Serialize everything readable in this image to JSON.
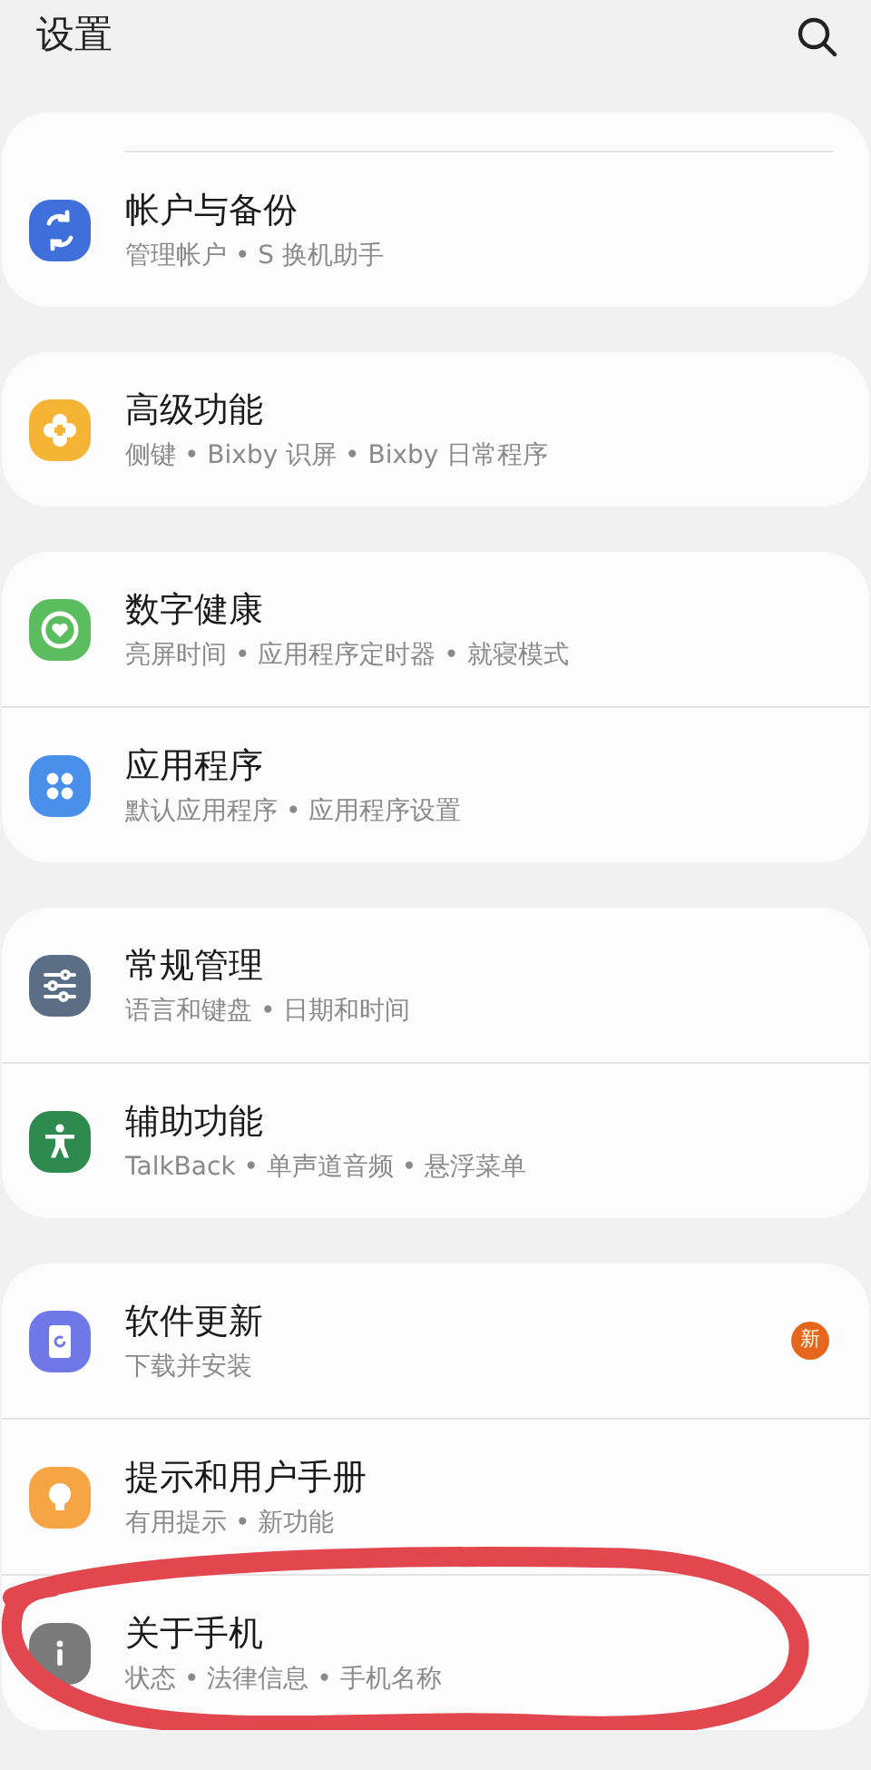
{
  "header": {
    "title": "设置"
  },
  "sections": [
    {
      "scrolled_under_header": true,
      "items": [
        {
          "kind": "sync",
          "color": "#3f6fdb",
          "title": "帐户与备份",
          "subtitle": "管理帐户 • S 换机助手"
        }
      ]
    },
    {
      "items": [
        {
          "kind": "plus-flower",
          "color": "#f6b437",
          "title": "高级功能",
          "subtitle": "侧键 • Bixby 识屏 • Bixby 日常程序"
        }
      ]
    },
    {
      "items": [
        {
          "kind": "heart-ring",
          "color": "#5cbd5e",
          "title": "数字健康",
          "subtitle": "亮屏时间 • 应用程序定时器 • 就寝模式"
        },
        {
          "kind": "dots",
          "color": "#4a90ea",
          "title": "应用程序",
          "subtitle": "默认应用程序 • 应用程序设置"
        }
      ]
    },
    {
      "items": [
        {
          "kind": "sliders",
          "color": "#5a6e86",
          "title": "常规管理",
          "subtitle": "语言和键盘 • 日期和时间"
        },
        {
          "kind": "person",
          "color": "#2e8a4e",
          "title": "辅助功能",
          "subtitle": "TalkBack • 单声道音频 • 悬浮菜单"
        }
      ]
    },
    {
      "items": [
        {
          "kind": "update",
          "color": "#6f78e6",
          "title": "软件更新",
          "subtitle": "下载并安装",
          "badge": "新"
        },
        {
          "kind": "bulb",
          "color": "#f6a545",
          "title": "提示和用户手册",
          "subtitle": "有用提示 • 新功能"
        },
        {
          "kind": "info",
          "color": "#7a7a7a",
          "title": "关于手机",
          "subtitle": "状态 • 法律信息 • 手机名称",
          "circled": true
        }
      ]
    }
  ]
}
